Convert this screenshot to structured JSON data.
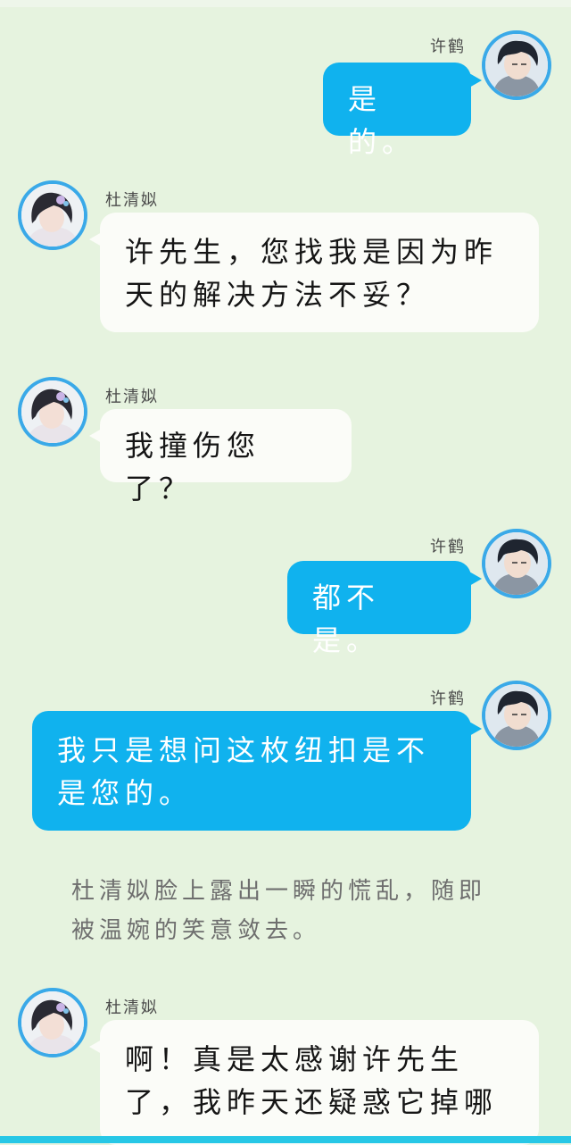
{
  "speakers": {
    "xuhe": "许鹤",
    "du": "杜清姒"
  },
  "messages": [
    {
      "speaker": "许鹤",
      "text": "是的。"
    },
    {
      "speaker": "杜清姒",
      "text": "许先生，您找我是因为昨天的解决方法不妥？"
    },
    {
      "speaker": "杜清姒",
      "text": "我撞伤您了？"
    },
    {
      "speaker": "许鹤",
      "text": "都不是。"
    },
    {
      "speaker": "许鹤",
      "text": "我只是想问这枚纽扣是不是您的。"
    },
    {
      "speaker": "杜清姒",
      "text": "啊！真是太感谢许先生了，我昨天还疑惑它掉哪"
    }
  ],
  "narration": "杜清姒脸上露出一瞬的慌乱，随即被温婉的笑意敛去。",
  "colors": {
    "background": "#e6f3df",
    "blue_bubble": "#10b2ee",
    "white_bubble": "#fbfcf8",
    "avatar_ring": "#3aa9e8"
  }
}
